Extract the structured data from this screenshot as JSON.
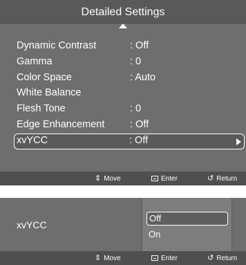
{
  "detailed_settings": {
    "title": "Detailed Settings",
    "items": [
      {
        "label": "Dynamic Contrast",
        "value": ": Off"
      },
      {
        "label": "Gamma",
        "value": ": 0"
      },
      {
        "label": "Color Space",
        "value": ": Auto"
      },
      {
        "label": "White Balance",
        "value": ""
      },
      {
        "label": "Flesh Tone",
        "value": ": 0"
      },
      {
        "label": "Edge Enhancement",
        "value": ": Off"
      },
      {
        "label": "xvYCC",
        "value": ": Off"
      }
    ],
    "selected_index": 6,
    "footer": {
      "move": "Move",
      "enter": "Enter",
      "return": "Return"
    }
  },
  "xvycc_screen": {
    "label": "xvYCC",
    "options": [
      "Off",
      "On"
    ],
    "selected": "Off",
    "footer": {
      "move": "Move",
      "enter": "Enter",
      "return": "Return"
    }
  },
  "icons": {
    "up": "up-arrow-icon",
    "right": "right-arrow-icon",
    "move": "move-icon",
    "enter": "enter-icon",
    "return": "return-icon"
  },
  "colors": {
    "background": "#6e6e6e",
    "title_bar": "#595959",
    "footer": "#4f4f4f",
    "text": "#ffffff"
  }
}
